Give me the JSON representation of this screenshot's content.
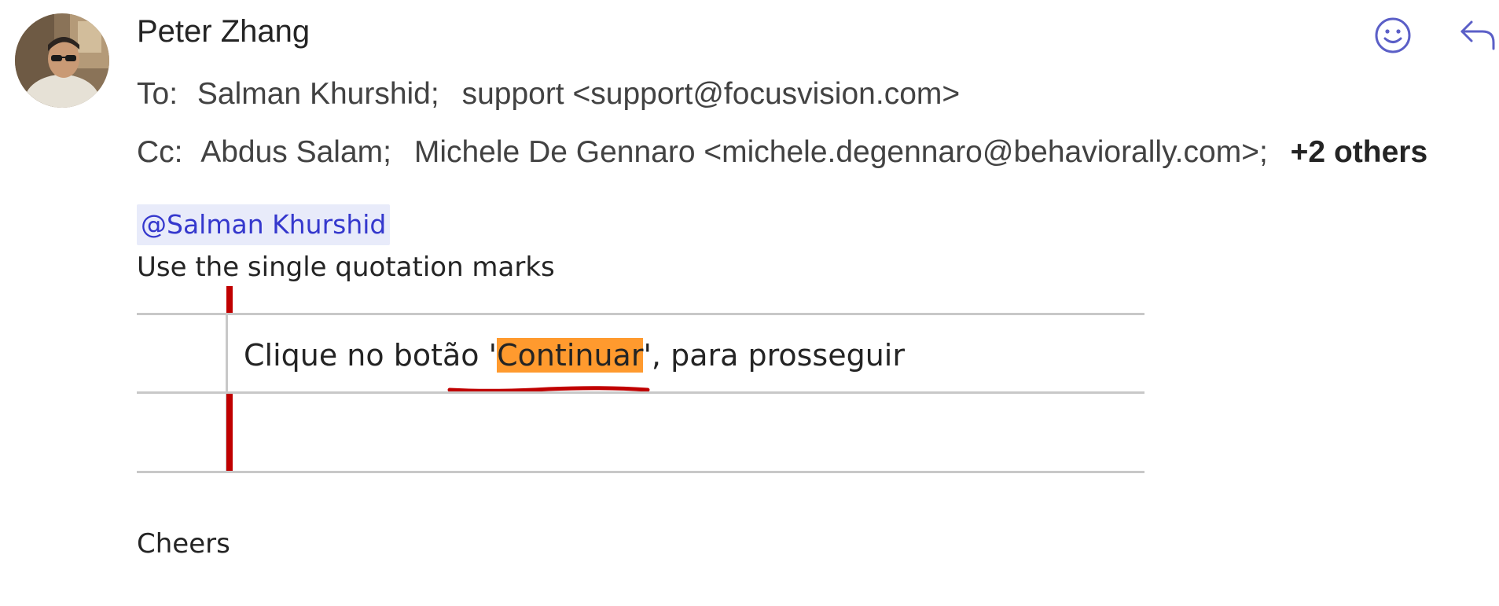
{
  "message": {
    "sender_name": "Peter Zhang",
    "to_label": "To:",
    "to_recipients": [
      "Salman Khurshid;",
      "support <support@focusvision.com>"
    ],
    "cc_label": "Cc:",
    "cc_recipients": [
      "Abdus Salam;",
      "Michele De Gennaro <michele.degennaro@behaviorally.com>;"
    ],
    "cc_more": "+2 others",
    "actions": {
      "react_icon": "smiley-icon",
      "reply_icon": "reply-arrow-icon"
    }
  },
  "body": {
    "mention": "@Salman Khurshid",
    "instruction": "Use the single quotation marks",
    "table_cell": {
      "before": "Clique no botão '",
      "highlighted": "Continuar",
      "after": "', para prosseguir"
    },
    "signoff": "Cheers"
  },
  "colors": {
    "mention_text": "#3538cd",
    "mention_bg": "#e8ebfa",
    "highlight": "#ff9a2e",
    "annotation_red": "#c00000",
    "icon_accent": "#5b5fc7"
  }
}
